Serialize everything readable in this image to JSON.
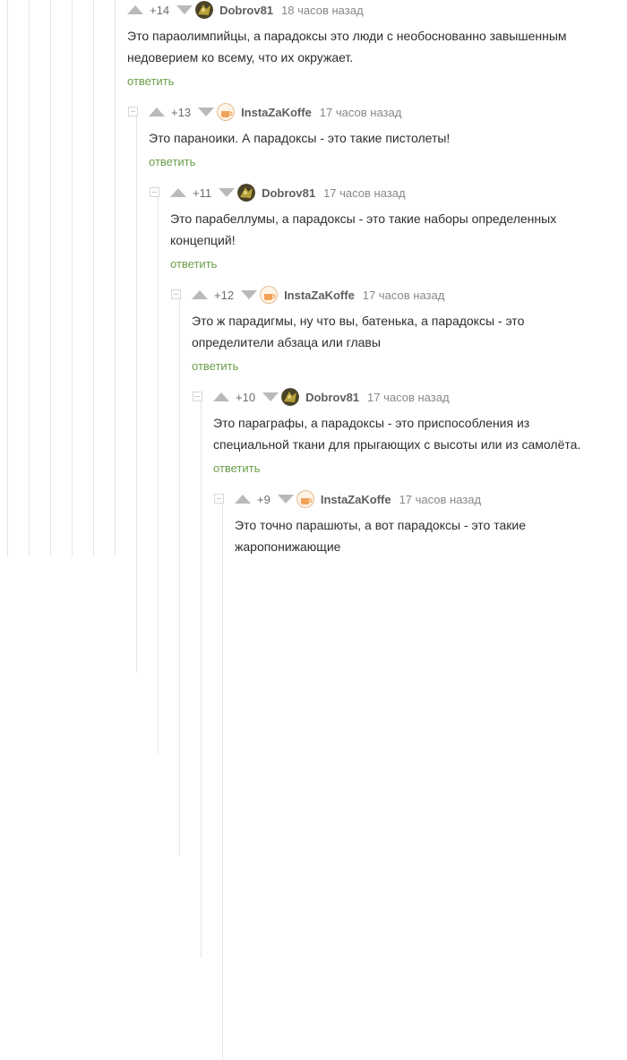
{
  "comments": [
    {
      "rating": "+14",
      "user": "Dobrov81",
      "time": "18 часов назад",
      "line1": "Это параолимпийцы, а парадоксы это люди с необоснованно завышенным",
      "line2": "недоверием ко всему, что их окружает.",
      "reply": "ответить",
      "avatar": "dobrov"
    },
    {
      "rating": "+13",
      "user": "InstaZaKoffe",
      "time": "17 часов назад",
      "line1": "Это параноики. А парадоксы - это такие пистолеты!",
      "line2": "",
      "reply": "ответить",
      "avatar": "insta"
    },
    {
      "rating": "+11",
      "user": "Dobrov81",
      "time": "17 часов назад",
      "line1": "Это парабеллумы, а парадоксы - это такие наборы определенных",
      "line2": "концепций!",
      "reply": "ответить",
      "avatar": "dobrov"
    },
    {
      "rating": "+12",
      "user": "InstaZaKoffe",
      "time": "17 часов назад",
      "line1": "Это ж парадигмы, ну что вы, батенька, а парадоксы - это",
      "line2": "определители абзаца или главы",
      "reply": "ответить",
      "avatar": "insta"
    },
    {
      "rating": "+10",
      "user": "Dobrov81",
      "time": "17 часов назад",
      "line1": "Это параграфы, а парадоксы - это приспособления из",
      "line2": "специальной ткани для прыгающих с высоты или из самолёта.",
      "reply": "ответить",
      "avatar": "dobrov"
    },
    {
      "rating": "+9",
      "user": "InstaZaKoffe",
      "time": "17 часов назад",
      "line1": "Это точно парашюты, а вот парадоксы - это такие",
      "line2": "жаропонижающие",
      "reply": "",
      "avatar": "insta"
    }
  ],
  "icons": {
    "upvote": "arrow-up-icon",
    "downvote": "arrow-down-icon",
    "collapse": "collapse-minus-icon"
  },
  "colors": {
    "reply_link": "#6a9f48",
    "vote_arrow": "#b9b9b9",
    "thread_line": "#e6e6e6"
  }
}
